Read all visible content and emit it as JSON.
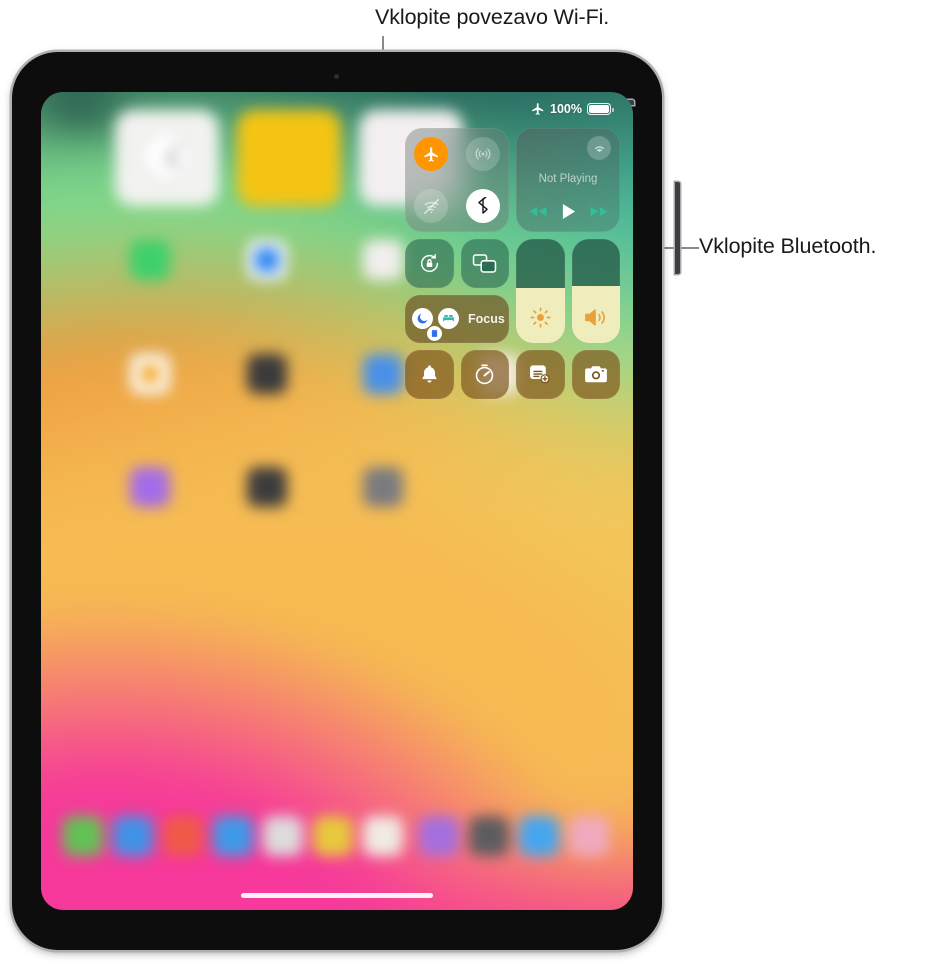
{
  "callouts": [
    {
      "id": "wifi",
      "text": "Vklopite povezavo Wi-Fi."
    },
    {
      "id": "bluetooth",
      "text": "Vklopite Bluetooth."
    }
  ],
  "device": {
    "name": "iPad",
    "orientation": "portrait",
    "buttons": {
      "power": "power-button",
      "volume": "volume-buttons"
    }
  },
  "status_bar": {
    "airplane_icon": "airplane-icon",
    "battery_percent": "100%",
    "battery_level": 100
  },
  "control_center": {
    "connectivity": {
      "airplane_mode": {
        "label": "Airplane Mode",
        "icon": "airplane-icon",
        "state": "on"
      },
      "cellular": {
        "label": "Cellular Data",
        "icon": "cellular-icon",
        "state": "off"
      },
      "wifi": {
        "label": "Wi-Fi",
        "icon": "wifi-slash-icon",
        "state": "off"
      },
      "bluetooth": {
        "label": "Bluetooth",
        "icon": "bluetooth-icon",
        "state": "on"
      }
    },
    "now_playing": {
      "title": "Not Playing",
      "airplay_icon": "airplay-audio-icon",
      "rewind_icon": "rewind-icon",
      "play_icon": "play-icon",
      "forward_icon": "fast-forward-icon"
    },
    "tiles": [
      {
        "id": "rotation-lock",
        "label": "Rotation Lock",
        "icon": "rotation-lock-icon"
      },
      {
        "id": "screen-mirroring",
        "label": "Screen Mirroring",
        "icon": "screen-mirroring-icon"
      },
      {
        "id": "silent-mode",
        "label": "Silent Mode",
        "icon": "bell-icon"
      },
      {
        "id": "timer",
        "label": "Timer",
        "icon": "timer-icon"
      },
      {
        "id": "quick-note",
        "label": "Quick Note",
        "icon": "quick-note-icon"
      },
      {
        "id": "camera",
        "label": "Camera",
        "icon": "camera-icon"
      }
    ],
    "focus": {
      "label": "Focus",
      "badges": [
        "moon-icon",
        "bed-icon",
        "reading-icon"
      ]
    },
    "brightness": {
      "label": "Display Brightness",
      "icon": "brightness-icon",
      "value": 53
    },
    "volume": {
      "label": "Volume",
      "icon": "speaker-icon",
      "value": 55
    }
  },
  "home_screen": {
    "blurred": true,
    "home_indicator": "home-indicator",
    "widgets": [
      {
        "name": "clock-widget",
        "color": "#f2f2f0"
      },
      {
        "name": "notes-widget",
        "color": "#f3c413"
      },
      {
        "name": "photos-widget",
        "color": "#f4eff0"
      }
    ],
    "dock_icon_colors": [
      "#62c254",
      "#3f93e8",
      "#ef5a47",
      "#3d9ae8",
      "#dcdcdc",
      "#e8c93c",
      "#f0ece2",
      "#a46fe0",
      "#5c5c60",
      "#45a6ef",
      "#f0a9c0"
    ],
    "app_icon_colors": [
      "#3ed06b",
      "#3a86f0",
      "#f4f2f0",
      "#f5a623",
      "#3a3a3c",
      "#4a90e8",
      "#f5f0ee",
      "#a36ce8",
      "#3c3c3e",
      "#7a7a80"
    ]
  },
  "colors": {
    "accent_orange": "#ff9500",
    "accent_white": "#ffffff",
    "callout_text": "#1a1a1a",
    "leader_line": "#8a8a8a",
    "bezel": "#0d0d0d",
    "bezel_rim": "#aeb0b3"
  }
}
